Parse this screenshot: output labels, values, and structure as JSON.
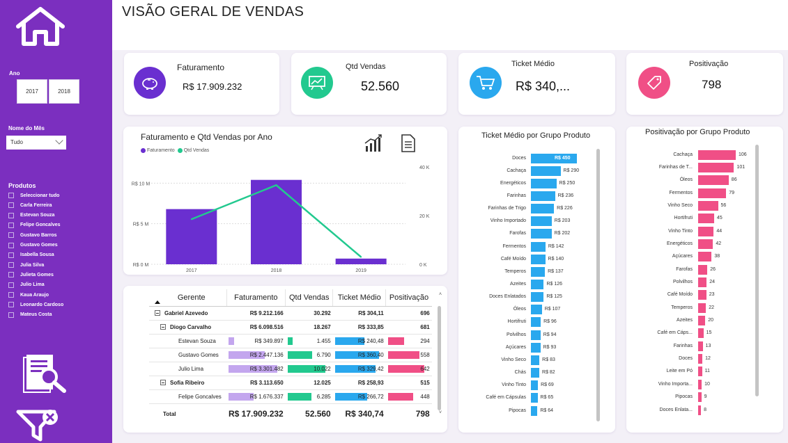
{
  "page": {
    "title": "VISÃO GERAL DE VENDAS"
  },
  "filters": {
    "ano_label": "Ano",
    "years": [
      "2017",
      "2018"
    ],
    "mes_label": "Nome do Mês",
    "mes_value": "Tudo",
    "produtos_label": "Produtos",
    "produtos": [
      "Seleccionar tudo",
      "Carla Ferreira",
      "Estevan Souza",
      "Felipe Goncalves",
      "Gustavo Barros",
      "Gustavo Gomes",
      "Isabella Sousa",
      "Julia Silva",
      "Julieta Gomes",
      "Julio Lima",
      "Kaua Araujo",
      "Leonardo Cardoso",
      "Mateus Costa"
    ]
  },
  "kpis": [
    {
      "title": "Faturamento",
      "value": "R$ 17.909.232",
      "color": "#6a2fd0",
      "icon": "piggy-bank-icon"
    },
    {
      "title": "Qtd Vendas",
      "value": "52.560",
      "color": "#22c98f",
      "icon": "presentation-chart-icon"
    },
    {
      "title": "Ticket Médio",
      "value": "R$ 340,...",
      "color": "#2aa8ee",
      "icon": "shopping-cart-icon"
    },
    {
      "title": "Positivação",
      "value": "798",
      "color": "#f04f86",
      "icon": "price-tag-icon"
    }
  ],
  "combo": {
    "title": "Faturamento e Qtd Vendas por Ano",
    "legend": [
      "Faturamento",
      "Qtd Vendas"
    ],
    "left_ticks": [
      "R$ 10 M",
      "R$ 5 M",
      "R$ 0 M"
    ],
    "right_ticks": [
      "40 K",
      "20 K",
      "0 K"
    ],
    "x_labels": [
      "2017",
      "2018",
      "2019"
    ]
  },
  "ticket": {
    "title": "Ticket Médio por Grupo Produto"
  },
  "posit": {
    "title": "Positivação por Grupo Produto"
  },
  "matrix": {
    "headers": [
      "Gerente",
      "Faturamento",
      "Qtd Vendas",
      "Ticket Médio",
      "Positivação"
    ],
    "rows": [
      {
        "level": 0,
        "name": "Gabriel Azevedo",
        "fat": "R$ 9.212.166",
        "qtd": "30.292",
        "tic": "R$ 304,11",
        "pos": "696"
      },
      {
        "level": 1,
        "name": "Diogo Carvalho",
        "fat": "R$ 6.098.516",
        "qtd": "18.267",
        "tic": "R$ 333,85",
        "pos": "681"
      },
      {
        "level": 2,
        "name": "Estevan Souza",
        "fat": "R$ 349.897",
        "qtd": "1.455",
        "tic": "R$ 240,48",
        "pos": "294",
        "bars": {
          "fat": 0.11,
          "qtd": 0.14,
          "tic": 0.66,
          "pos": 0.44
        }
      },
      {
        "level": 2,
        "name": "Gustavo Gomes",
        "fat": "R$ 2.447.136",
        "qtd": "6.790",
        "tic": "R$ 360,40",
        "pos": "558",
        "bars": {
          "fat": 0.74,
          "qtd": 0.66,
          "tic": 0.99,
          "pos": 0.84
        }
      },
      {
        "level": 2,
        "name": "Julio Lima",
        "fat": "R$ 3.301.482",
        "qtd": "10.022",
        "tic": "R$ 329,42",
        "pos": "642",
        "bars": {
          "fat": 1.0,
          "qtd": 1.0,
          "tic": 0.91,
          "pos": 0.97
        }
      },
      {
        "level": 1,
        "name": "Sofia Ribeiro",
        "fat": "R$ 3.113.650",
        "qtd": "12.025",
        "tic": "R$ 258,93",
        "pos": "515"
      },
      {
        "level": 2,
        "name": "Felipe Goncalves",
        "fat": "R$ 1.676.337",
        "qtd": "6.285",
        "tic": "R$ 266,72",
        "pos": "448",
        "bars": {
          "fat": 0.51,
          "qtd": 0.63,
          "tic": 0.73,
          "pos": 0.68
        }
      }
    ],
    "total": {
      "name": "Total",
      "fat": "R$ 17.909.232",
      "qtd": "52.560",
      "tic": "R$ 340,74",
      "pos": "798"
    }
  },
  "colors": {
    "sidebar": "#7b2fbf",
    "fat": "#6a2fd0",
    "qtd": "#22c98f",
    "ticket": "#2aa8ee",
    "posit": "#f04f86",
    "fat_light": "#c3a6ee"
  },
  "chart_data": [
    {
      "type": "bar",
      "title": "Faturamento e Qtd Vendas por Ano",
      "categories": [
        "2017",
        "2018",
        "2019"
      ],
      "series": [
        {
          "name": "Faturamento",
          "type": "bar",
          "axis": "left",
          "values": [
            6800000,
            10400000,
            700000
          ]
        },
        {
          "name": "Qtd Vendas",
          "type": "line",
          "axis": "right",
          "values": [
            18500,
            32500,
            3000
          ]
        }
      ],
      "ylim_left": [
        0,
        12000000
      ],
      "ylim_right": [
        0,
        40000
      ]
    },
    {
      "type": "bar",
      "title": "Ticket Médio por Grupo Produto",
      "orientation": "horizontal",
      "categories": [
        "Doces",
        "Cachaça",
        "Energéticos",
        "Farinhas",
        "Farinhas de Trigo",
        "Vinho Importado",
        "Farofas",
        "Fermentos",
        "Café Moído",
        "Temperos",
        "Azeites",
        "Doces Enlatados",
        "Óleos",
        "Hortifruti",
        "Polvilhos",
        "Açúcares",
        "Vinho Seco",
        "Chás",
        "Vinho Tinto",
        "Café em Cápsulas",
        "Pipocas"
      ],
      "values": [
        450,
        290,
        250,
        236,
        226,
        203,
        202,
        142,
        140,
        137,
        126,
        125,
        107,
        96,
        94,
        93,
        83,
        82,
        69,
        65,
        64
      ],
      "labels": [
        "R$ 450",
        "R$ 290",
        "R$ 250",
        "R$ 236",
        "R$ 226",
        "R$ 203",
        "R$ 202",
        "R$ 142",
        "R$ 140",
        "R$ 137",
        "R$ 126",
        "R$ 125",
        "R$ 107",
        "R$ 96",
        "R$ 94",
        "R$ 93",
        "R$ 83",
        "R$ 82",
        "R$ 69",
        "R$ 65",
        "R$ 64"
      ]
    },
    {
      "type": "bar",
      "title": "Positivação por Grupo Produto",
      "orientation": "horizontal",
      "categories": [
        "Cachaça",
        "Farinhas de T...",
        "Óleos",
        "Fermentos",
        "Vinho Seco",
        "Hortifruti",
        "Vinho Tinto",
        "Energéticos",
        "Açúcares",
        "Farofas",
        "Polvilhos",
        "Café Moído",
        "Temperos",
        "Azeites",
        "Café em Cáps...",
        "Farinhas",
        "Doces",
        "Leite em Pó",
        "Vinho Importa...",
        "Pipocas",
        "Doces Enlata..."
      ],
      "values": [
        106,
        101,
        86,
        79,
        56,
        45,
        44,
        42,
        38,
        26,
        24,
        23,
        22,
        20,
        15,
        13,
        12,
        11,
        10,
        9,
        8
      ]
    }
  ]
}
